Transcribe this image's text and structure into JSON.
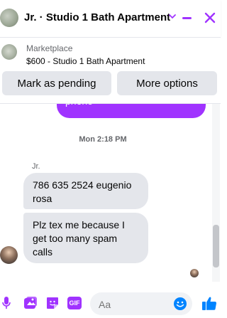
{
  "header": {
    "title": "Jr. · Studio 1 Bath Apartment",
    "cut_line": "....... ..... ..... ........."
  },
  "marketplace": {
    "label": "Marketplace",
    "listing": "$600 - Studio 1 Bath Apartment",
    "pending_button": "Mark as pending",
    "more_button": "More options"
  },
  "conversation": {
    "outgoing_tail": "phone",
    "timestamp": "Mon 2:18 PM",
    "sender_name": "Jr.",
    "messages": [
      "786 635 2524 eugenio rosa",
      "Plz tex me because I get too many spam calls"
    ]
  },
  "composer": {
    "placeholder": "Aa",
    "gif_label": "GIF"
  },
  "colors": {
    "accent": "#a033ff",
    "bubble_in": "#e4e6eb",
    "like_blue": "#0084ff"
  },
  "icons": [
    "chevron-down-icon",
    "minimize-icon",
    "close-icon",
    "microphone-icon",
    "photo-icon",
    "sticker-icon",
    "gif-icon",
    "emoji-icon",
    "thumbs-up-icon"
  ]
}
